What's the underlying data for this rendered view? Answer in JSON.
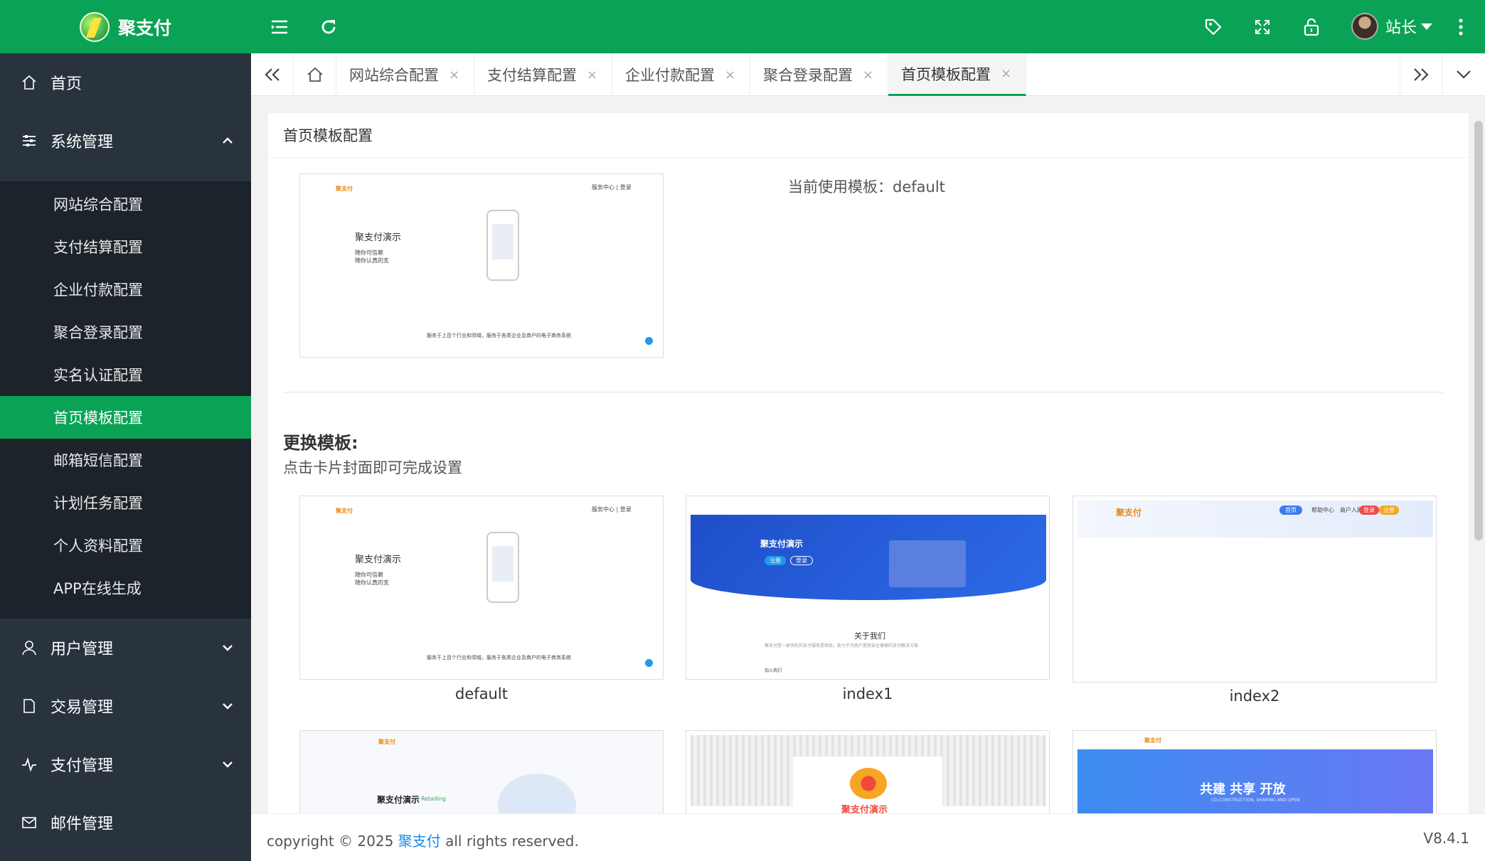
{
  "header": {
    "app_name": "聚支付",
    "user_name": "站长",
    "icons": [
      "menu-toggle-icon",
      "refresh-icon",
      "tag-icon",
      "fullscreen-icon",
      "lock-icon",
      "more-icon"
    ]
  },
  "sidebar": {
    "home": "首页",
    "system": "系统管理",
    "system_items": [
      "网站综合配置",
      "支付结算配置",
      "企业付款配置",
      "聚合登录配置",
      "实名认证配置",
      "首页模板配置",
      "邮箱短信配置",
      "计划任务配置",
      "个人资料配置",
      "APP在线生成"
    ],
    "active_index": 5,
    "user_mgmt": "用户管理",
    "trade_mgmt": "交易管理",
    "pay_mgmt": "支付管理",
    "mail_mgmt": "邮件管理"
  },
  "tabs": {
    "items": [
      "网站综合配置",
      "支付结算配置",
      "企业付款配置",
      "聚合登录配置",
      "首页模板配置"
    ],
    "close": "×",
    "active_index": 4
  },
  "panel": {
    "title": "首页模板配置",
    "current_label": "当前使用模板：default",
    "change_title": "更换模板:",
    "change_desc": "点击卡片封面即可完成设置",
    "templates": [
      "default",
      "index1",
      "index2"
    ]
  },
  "thumbs": {
    "default": {
      "logo": "聚支付",
      "headline": "聚支付演示",
      "line1": "随你可信赖",
      "line2": "随你认真的支",
      "footer_text": "服务于上百个行业和领域，服务于各类企业及商户的电子商务系统",
      "topright": "服务中心 | 登录"
    },
    "index1": {
      "headline": "聚支付演示",
      "btn1": "注册",
      "btn2": "登录",
      "about": "关于我们",
      "about_desc": "聚支付是一家领先的支付服务提供商，致力于为商户提供安全便捷的支付解决方案",
      "join": "加入我们"
    },
    "index2": {
      "logo": "聚支付",
      "nav1": "首页",
      "nav2": "帮助中心",
      "nav3": "商户入网",
      "btn1": "登录",
      "btn2": "注册"
    },
    "index3": {
      "logo": "聚支付",
      "headline": "聚支付演示",
      "tag": "Retailing"
    },
    "index4": {
      "brand": "聚支付演示"
    },
    "index5": {
      "logo": "聚支付",
      "headline": "共建  共享  开放",
      "subline": "CO-CONSTRUCTION, SHARING AND OPEN"
    }
  },
  "footer": {
    "prefix": "copyright © 2025 ",
    "brand": "聚支付",
    "suffix": " all rights reserved.",
    "version": "V8.4.1"
  },
  "colors": {
    "primary": "#0aa355",
    "sidebar": "#28333e",
    "submenu": "#1c232a",
    "link": "#1e88e5"
  }
}
